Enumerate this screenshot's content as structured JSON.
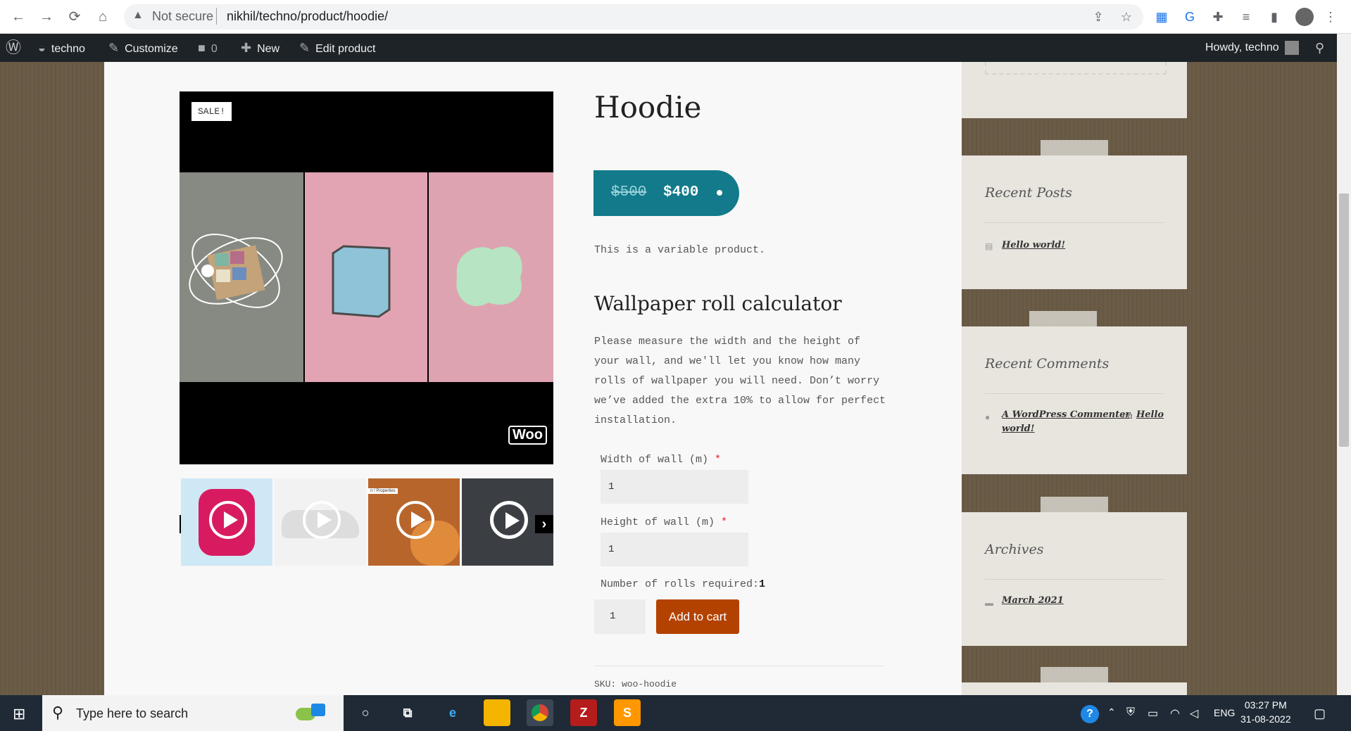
{
  "browser": {
    "url_warning": "Not secure",
    "url": "nikhil/techno/product/hoodie/"
  },
  "adminbar": {
    "site": "techno",
    "customize": "Customize",
    "comments": "0",
    "new": "New",
    "edit": "Edit product",
    "howdy": "Howdy, techno"
  },
  "product": {
    "sale_badge": "SALE!",
    "title": "Hoodie",
    "price_old": "$500",
    "price_new": "$400",
    "short_desc": "This is a variable product.",
    "calc_title": "Wallpaper roll calculator",
    "calc_desc": "Please measure the width and the height of your wall, and we'll let you know how many rolls of wallpaper you will need. Don’t worry we’ve added the extra 10% to allow for perfect installation.",
    "width_label": "Width of wall (m)",
    "width_value": "1",
    "height_label": "Height of wall (m)",
    "height_value": "1",
    "rolls_label": "Number of rolls required:",
    "rolls_value": "1",
    "qty": "1",
    "add_to_cart": "Add to cart",
    "sku": "SKU: woo-hoodie",
    "woo_logo": "Woo",
    "thumb3_caption": "n / Properties"
  },
  "sidebar": {
    "recent_posts_title": "Recent Posts",
    "recent_post_1": "Hello world!",
    "recent_comments_title": "Recent Comments",
    "commenter": "A WordPress Commenter",
    "on": "on",
    "comment_post_line1": "Hello",
    "comment_post_line2": "world!",
    "archives_title": "Archives",
    "archive_1": "March 2021"
  },
  "taskbar": {
    "search_placeholder": "Type here to search",
    "language": "ENG",
    "time": "03:27 PM",
    "date": "31-08-2022"
  },
  "colors": {
    "price_pill": "#127a8a",
    "add_to_cart": "#b34200",
    "admin_bar": "#1d2327"
  }
}
